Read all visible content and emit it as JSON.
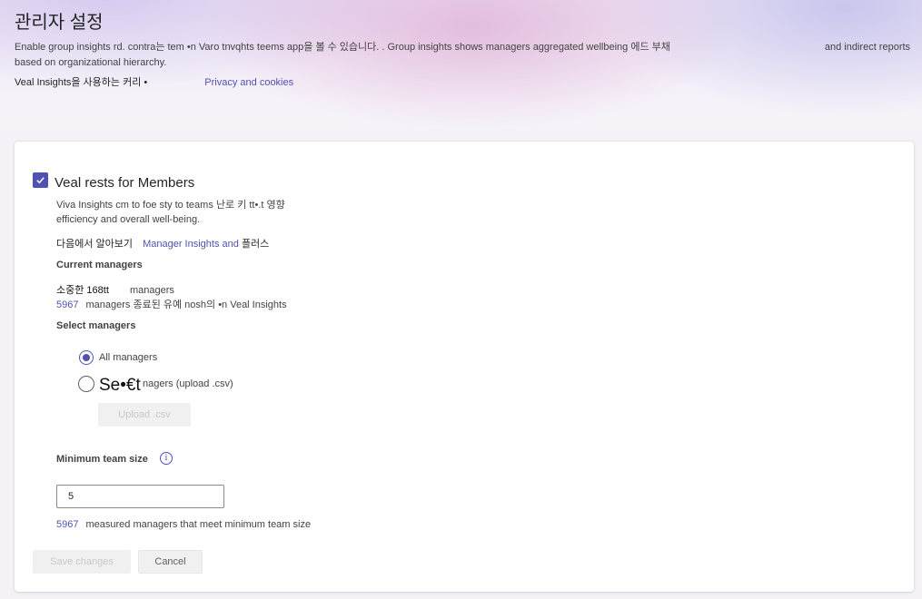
{
  "header": {
    "title": "관리자 설정",
    "description_part1": "Enable group insights rd. contra는 tem •n Varo tnvqhts teems app을 볼 수 있습니다. . Group insights shows managers aggregated wellbeing 에드 부채",
    "description_part2": "and indirect reports based on organizational hierarchy.",
    "consent_text": "Veal Insights을 사용하는 커리 •",
    "privacy_link": "Privacy and cookies"
  },
  "settings": {
    "section_title": "Veal rests for Members",
    "section_checked": true,
    "body_line1": "Viva Insights cm to foe sty to teams 난로 키 tt•.t 영향",
    "body_line2": "efficiency and overall well-being.",
    "learn_prefix": "다음에서 알아보기",
    "learn_link": "Manager Insights and",
    "learn_suffix": "플러스",
    "current_managers_label": "Current managers",
    "current_line1_prefix": "소중한 168tt",
    "current_line1_suffix": "managers",
    "current_line2_number": "5967",
    "current_line2_text": "managers 종료된 유예 nosh의 •n Veal Insights",
    "select_managers_label": "Select managers",
    "radio_all_label": "All managers",
    "radio_select_big": "Se•€t",
    "radio_select_rest": "nagers (upload .csv)",
    "upload_button": "Upload .csv",
    "min_team_label": "Minimum team size",
    "info_icon_glyph": "i",
    "min_team_value": "5",
    "meet_number": "5967",
    "meet_text": "measured managers that meet minimum team size",
    "save_button": "Save changes",
    "cancel_button": "Cancel"
  },
  "colors": {
    "accent": "#4f52b2",
    "text": "#242424",
    "disabled_text": "#c8c8c8"
  }
}
